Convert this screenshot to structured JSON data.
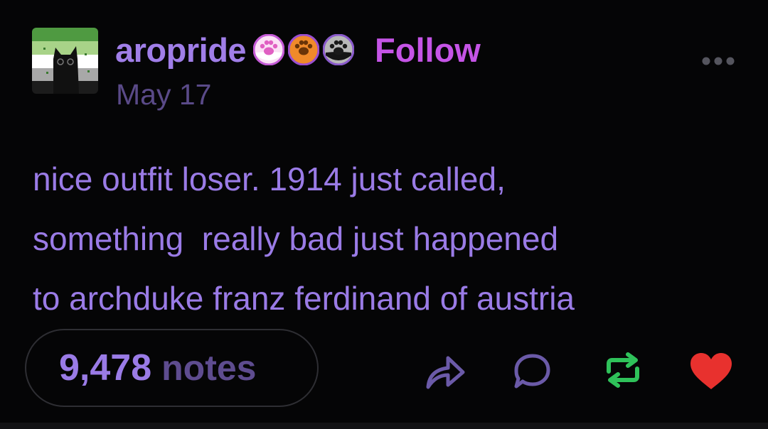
{
  "post": {
    "username": "aropride",
    "follow_label": "Follow",
    "date": "May 17",
    "badges": [
      {
        "icon": "paw-icon-pink",
        "color": "#e47bd6"
      },
      {
        "icon": "paw-icon-orange",
        "color": "#f08a2a"
      },
      {
        "icon": "paw-icon-gray",
        "color": "#8a8a8a"
      }
    ],
    "body_lines": [
      "nice outfit loser. 1914 just called,",
      "something  really bad just happened",
      "to archduke franz ferdinand of austria"
    ],
    "notes_count": "9,478",
    "notes_label": "notes",
    "actions": [
      {
        "name": "share",
        "icon": "share-arrow-icon"
      },
      {
        "name": "reply",
        "icon": "speech-bubble-icon"
      },
      {
        "name": "reblog",
        "icon": "reblog-icon"
      },
      {
        "name": "like",
        "icon": "heart-icon"
      }
    ]
  },
  "colors": {
    "background": "#050506",
    "accent_purple": "#9a7be6",
    "follow_magenta": "#c554e6",
    "muted_purple": "#5a4a88",
    "reblog_green": "#2fc25a",
    "like_red": "#e8312e"
  }
}
